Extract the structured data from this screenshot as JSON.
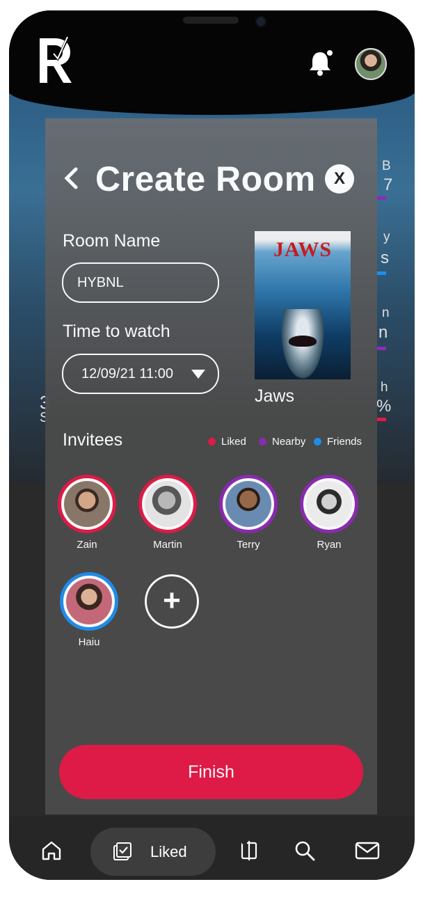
{
  "header": {
    "logo_letter": "R"
  },
  "modal": {
    "title": "Create Room",
    "close_label": "X",
    "room_name_label": "Room Name",
    "room_name_value": "HYBNL",
    "time_label": "Time to watch",
    "time_value": "12/09/21 11:00",
    "poster_title": "JAWS",
    "movie_name": "Jaws",
    "invitees_label": "Invitees",
    "legend": [
      {
        "label": "Liked",
        "color": "#e41a47"
      },
      {
        "label": "Nearby",
        "color": "#8e2bb5"
      },
      {
        "label": "Friends",
        "color": "#1f8ff0"
      }
    ],
    "invitees": [
      {
        "name": "Zain",
        "ring": "#e41a47"
      },
      {
        "name": "Martin",
        "ring": "#e41a47"
      },
      {
        "name": "Terry",
        "ring": "#8e2bb5"
      },
      {
        "name": "Ryan",
        "ring": "#8e2bb5"
      },
      {
        "name": "Haiu",
        "ring": "#1f8ff0"
      }
    ],
    "add_label": "+",
    "finish_label": "Finish"
  },
  "background_peek": {
    "right": [
      "B",
      "7",
      "y",
      "s",
      "n",
      "n",
      "h",
      "%"
    ],
    "left": [
      "3",
      "S"
    ]
  },
  "nav": {
    "liked_label": "Liked"
  }
}
